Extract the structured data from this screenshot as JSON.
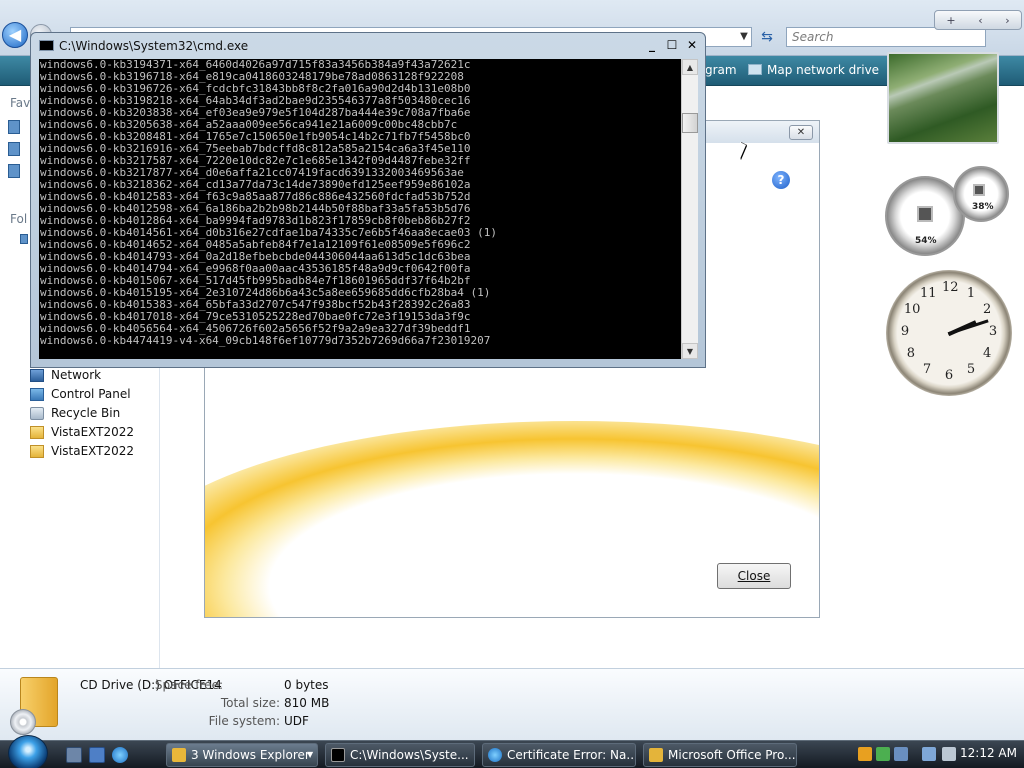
{
  "explorer": {
    "search_placeholder": "Search",
    "commands": [
      "gram",
      "Map network drive"
    ],
    "favorites_label": "Fav",
    "folders_label": "Fol",
    "tree": [
      {
        "label": "Network",
        "icon": "network-icon"
      },
      {
        "label": "Control Panel",
        "icon": "control-panel-icon"
      },
      {
        "label": "Recycle Bin",
        "icon": "recycle-bin-icon"
      },
      {
        "label": "VistaEXT2022",
        "icon": "folder-icon"
      },
      {
        "label": "VistaEXT2022",
        "icon": "folder-icon"
      }
    ],
    "details": {
      "title": "CD Drive (D:) OFFICE14",
      "space_free_label": "Space free:",
      "space_free": "0 bytes",
      "total_size_label": "Total size:",
      "total_size": "810 MB",
      "file_system_label": "File system:",
      "file_system": "UDF"
    }
  },
  "office_dialog": {
    "close_label": "Close"
  },
  "cmd": {
    "title": "C:\\Windows\\System32\\cmd.exe",
    "lines": [
      "windows6.0-kb3194371-x64_6460d4026a97d715f83a3456b384a9f43a72621c",
      "windows6.0-kb3196718-x64_e819ca0418603248179be78ad0863128f922208",
      "windows6.0-kb3196726-x64_fcdcbfc31843bb8f8c2fa016a90d2d4b131e08b0",
      "windows6.0-kb3198218-x64_64ab34df3ad2bae9d235546377a8f503480cec16",
      "windows6.0-kb3203838-x64_ef03ea9e979e5f104d287ba444e39c708a7fba6e",
      "windows6.0-kb3205638-x64_a52aaa009ee56ca941e21a6009c00bc48cbb7c",
      "windows6.0-kb3208481-x64_1765e7c150650e1fb9054c14b2c71fb7f5458bc0",
      "windows6.0-kb3216916-x64_75eebab7bdcffd8c812a585a2154ca6a3f45e110",
      "windows6.0-kb3217587-x64_7220e10dc82e7c1e685e1342f09d4487febe32ff",
      "windows6.0-kb3217877-x64_d0e6affa21cc07419facd6391332003469563ae",
      "windows6.0-kb3218362-x64_cd13a77da73c14de73890efd125eef959e86102a",
      "windows6.0-kb4012583-x64_f63c9a85aa877d86c886e432560fdcfad53b752d",
      "windows6.0-kb4012598-x64_6a186ba2b2b98b2144b50f88baf33a5fa53b5d76",
      "windows6.0-kb4012864-x64_ba9994fad9783d1b823f17859cb8f0beb86b27f2",
      "windows6.0-kb4014561-x64_d0b316e27cdfae1ba74335c7e6b5f46aa8ecae03 (1)",
      "windows6.0-kb4014652-x64_0485a5abfeb84f7e1a12109f61e08509e5f696c2",
      "windows6.0-kb4014793-x64_0a2d18efbebcbde044306044aa613d5c1dc63bea",
      "windows6.0-kb4014794-x64_e9968f0aa00aac43536185f48a9d9cf0642f00fa",
      "windows6.0-kb4015067-x64_517d45fb995badb84e7f18601965ddf37f64b2bf",
      "windows6.0-kb4015195-x64_2e310724d86b6a43c5a8ee659685dd6cfb28ba4 (1)",
      "windows6.0-kb4015383-x64_65bfa33d2707c547f938bcf52b43f28392c26a83",
      "windows6.0-kb4017018-x64_79ce5310525228ed70bae0fc72e3f19153da3f9c",
      "windows6.0-kb4056564-x64_4506726f602a5656f52f9a2a9ea327df39beddf1",
      "windows6.0-kb4474419-v4-x64_09cb148f6ef10779d7352b7269d66a7f23019207"
    ]
  },
  "gadgets": {
    "cpu_percent": "54%",
    "memory_percent": "38%",
    "clock_numbers": [
      "12",
      "1",
      "2",
      "3",
      "4",
      "5",
      "6",
      "7",
      "8",
      "9",
      "10",
      "11"
    ],
    "clock_time": {
      "hour": 2,
      "minute": 12
    }
  },
  "taskbar": {
    "tasks": [
      {
        "label": "Windows Explorer",
        "count": "3",
        "icon": "folder-icon"
      },
      {
        "label": "C:\\Windows\\Syste...",
        "icon": "cmd-icon"
      },
      {
        "label": "Certificate Error: Na...",
        "icon": "ie-icon"
      },
      {
        "label": "Microsoft Office Pro...",
        "icon": "office-setup-icon"
      }
    ],
    "time": "12:12 AM"
  },
  "colors": {
    "cmd_bg": "#000000",
    "cmd_text": "#c0c0c0",
    "command_bar": "#2d7191",
    "accent": "#1d67c4"
  }
}
